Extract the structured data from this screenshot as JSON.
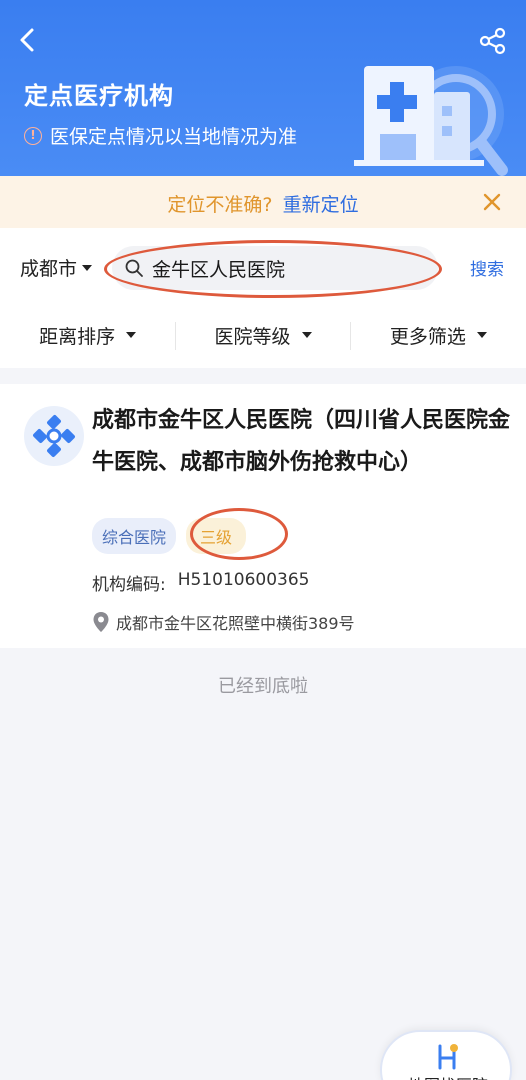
{
  "header": {
    "title": "定点医疗机构",
    "notice": "医保定点情况以当地情况为准",
    "info_glyph": "!"
  },
  "location_banner": {
    "question": "定位不准确?",
    "relocate": "重新定位"
  },
  "search": {
    "city": "成都市",
    "query": "金牛区人民医院",
    "button": "搜索"
  },
  "filters": [
    {
      "label": "距离排序"
    },
    {
      "label": "医院等级"
    },
    {
      "label": "更多筛选"
    }
  ],
  "hospital": {
    "name": "成都市金牛区人民医院（四川省人民医院金牛医院、成都市脑外伤抢救中心）",
    "type_tag": "综合医院",
    "level_tag": "三级",
    "code_label": "机构编码:",
    "code_value": "H51010600365",
    "address": "成都市金牛区花照壁中横街389号"
  },
  "end_text": "已经到底啦",
  "map_button": {
    "label": "地图找医院"
  },
  "colors": {
    "header_blue": "#3a7ef0",
    "link_blue": "#2f6de0",
    "banner_bg": "#fdf3e6",
    "banner_orange": "#e0952c",
    "annotation_red": "#de5a3c",
    "level_tag_text": "#e5a233"
  }
}
